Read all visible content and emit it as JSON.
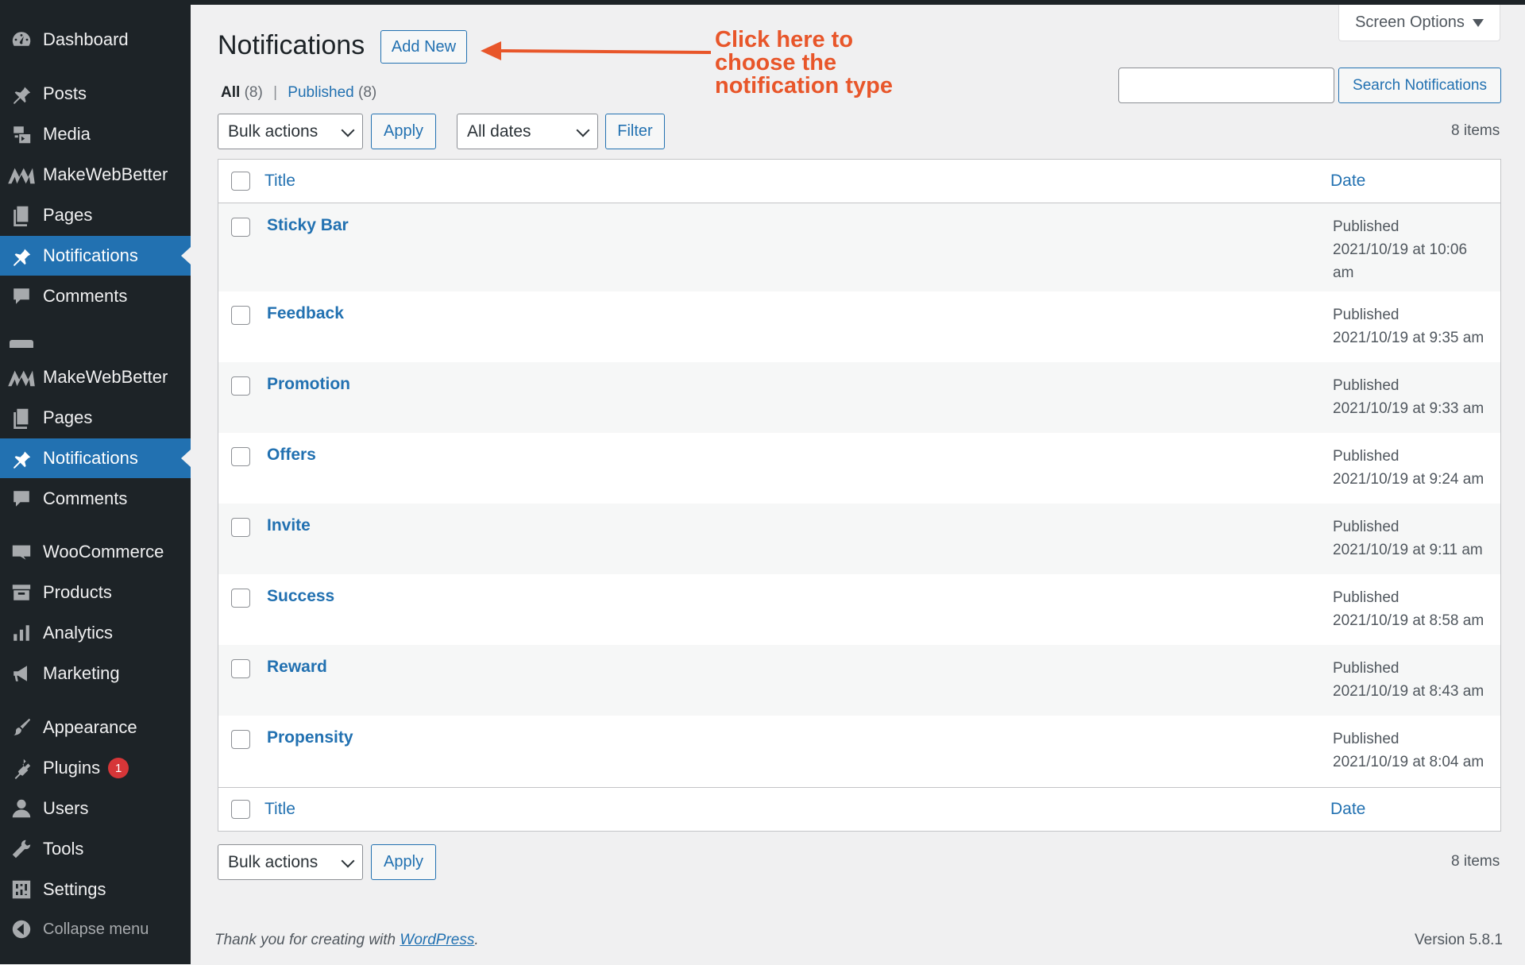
{
  "sidebar": {
    "items": [
      {
        "label": "Dashboard",
        "icon": "dashboard-icon"
      },
      {
        "label": "Posts",
        "icon": "pin-icon"
      },
      {
        "label": "Media",
        "icon": "media-icon"
      },
      {
        "label": "MakeWebBetter",
        "icon": "makewebbetter-logo-icon"
      },
      {
        "label": "Pages",
        "icon": "pages-icon"
      },
      {
        "label": "Notifications",
        "icon": "pin-icon",
        "current": true
      },
      {
        "label": "Comments",
        "icon": "comment-icon"
      },
      {
        "label": "MakeWebBetter",
        "icon": "makewebbetter-logo-icon"
      },
      {
        "label": "Pages",
        "icon": "pages-icon"
      },
      {
        "label": "Notifications",
        "icon": "pin-icon",
        "current": true
      },
      {
        "label": "Comments",
        "icon": "comment-icon"
      },
      {
        "label": "WooCommerce",
        "icon": "woocommerce-icon"
      },
      {
        "label": "Products",
        "icon": "archive-icon"
      },
      {
        "label": "Analytics",
        "icon": "chart-bar-icon"
      },
      {
        "label": "Marketing",
        "icon": "megaphone-icon"
      },
      {
        "label": "Appearance",
        "icon": "paintbrush-icon"
      },
      {
        "label": "Plugins",
        "icon": "plugin-icon",
        "badge": "1"
      },
      {
        "label": "Users",
        "icon": "user-icon"
      },
      {
        "label": "Tools",
        "icon": "wrench-icon"
      },
      {
        "label": "Settings",
        "icon": "settings-sliders-icon"
      },
      {
        "label": "Collapse menu",
        "icon": "collapse-arrow-icon"
      }
    ]
  },
  "header": {
    "screen_options": "Screen Options",
    "title": "Notifications",
    "add_new": "Add New",
    "annotation": "Click here to choose the notification type"
  },
  "views": {
    "all_label": "All",
    "all_count": "(8)",
    "separator": "|",
    "published_label": "Published",
    "published_count": "(8)"
  },
  "search": {
    "value": "",
    "button": "Search Notifications"
  },
  "tablenav_top": {
    "bulk_actions": "Bulk actions",
    "apply": "Apply",
    "dates": "All dates",
    "filter": "Filter",
    "items": "8 items"
  },
  "table": {
    "columns": {
      "title": "Title",
      "date": "Date"
    },
    "rows": [
      {
        "title": "Sticky Bar",
        "status": "Published",
        "date": "2021/10/19 at 10:06 am"
      },
      {
        "title": "Feedback",
        "status": "Published",
        "date": "2021/10/19 at 9:35 am"
      },
      {
        "title": "Promotion",
        "status": "Published",
        "date": "2021/10/19 at 9:33 am"
      },
      {
        "title": "Offers",
        "status": "Published",
        "date": "2021/10/19 at 9:24 am"
      },
      {
        "title": "Invite",
        "status": "Published",
        "date": "2021/10/19 at 9:11 am"
      },
      {
        "title": "Success",
        "status": "Published",
        "date": "2021/10/19 at 8:58 am"
      },
      {
        "title": "Reward",
        "status": "Published",
        "date": "2021/10/19 at 8:43 am"
      },
      {
        "title": "Propensity",
        "status": "Published",
        "date": "2021/10/19 at 8:04 am"
      }
    ]
  },
  "tablenav_bottom": {
    "bulk_actions": "Bulk actions",
    "apply": "Apply",
    "items": "8 items"
  },
  "footer": {
    "thanks_prefix": "Thank you for creating with ",
    "thanks_link": "WordPress",
    "thanks_suffix": ".",
    "version": "Version 5.8.1"
  },
  "colors": {
    "sidebar_bg": "#1d2327",
    "accent": "#2271b1",
    "annotation": "#e8562a",
    "badge": "#d63638"
  }
}
